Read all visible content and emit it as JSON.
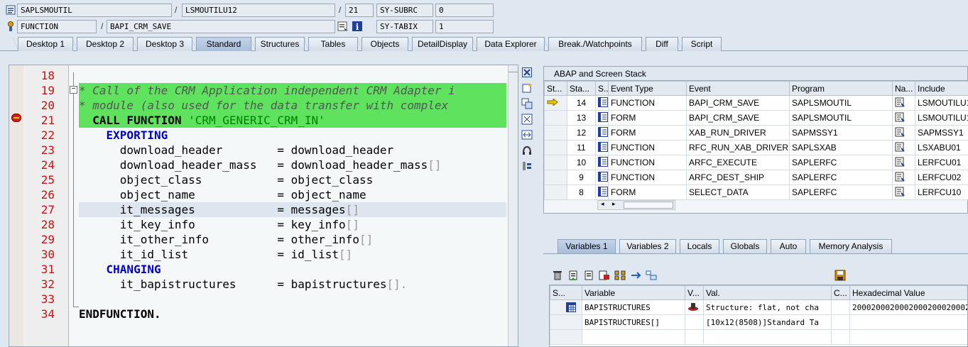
{
  "header": {
    "program": "SAPLSMOUTIL",
    "include": "LSMOUTILU12",
    "line": "21",
    "subrc_label": "SY-SUBRC",
    "subrc_value": "0",
    "event_type": "FUNCTION",
    "event": "BAPI_CRM_SAVE",
    "tabix_label": "SY-TABIX",
    "tabix_value": "1",
    "slash": "/"
  },
  "tabs": [
    "Desktop 1",
    "Desktop 2",
    "Desktop 3",
    "Standard",
    "Structures",
    "Tables",
    "Objects",
    "DetailDisplay",
    "Data Explorer",
    "Break./Watchpoints",
    "Diff",
    "Script"
  ],
  "active_tab": "Standard",
  "code": [
    {
      "num": "18",
      "text": ""
    },
    {
      "num": "19",
      "text": "* Call of the CRM Application independent CRM Adapter i"
    },
    {
      "num": "20",
      "text": "* module (also used for the data transfer with complex"
    },
    {
      "num": "21",
      "text_parts": [
        "  CALL FUNCTION ",
        "'CRM_GENERIC_CRM_IN'"
      ]
    },
    {
      "num": "22",
      "text": "    EXPORTING"
    },
    {
      "num": "23",
      "text": "      download_header        = download_header"
    },
    {
      "num": "24",
      "text": "      download_header_mass   = download_header_mass",
      "brk": "[]"
    },
    {
      "num": "25",
      "text": "      object_class           = object_class"
    },
    {
      "num": "26",
      "text": "      object_name            = object_name"
    },
    {
      "num": "27",
      "text": "      it_messages            = messages",
      "brk": "[]"
    },
    {
      "num": "28",
      "text": "      it_key_info            = key_info",
      "brk": "[]"
    },
    {
      "num": "29",
      "text": "      it_other_info          = other_info",
      "brk": "[]"
    },
    {
      "num": "30",
      "text": "      it_id_list             = id_list",
      "brk": "[]"
    },
    {
      "num": "31",
      "text": "    CHANGING"
    },
    {
      "num": "32",
      "text": "      it_bapistructures      = bapistructures",
      "brk": "[]."
    },
    {
      "num": "33",
      "text": ""
    },
    {
      "num": "34",
      "text": "ENDFUNCTION."
    }
  ],
  "stack": {
    "title": "ABAP and Screen Stack",
    "columns": [
      "St...",
      "Sta...",
      "S...",
      "Event Type",
      "Event",
      "Program",
      "Na...",
      "Include"
    ],
    "rows": [
      {
        "level": "14",
        "type": "FUNCTION",
        "event": "BAPI_CRM_SAVE",
        "program": "SAPLSMOUTIL",
        "include": "LSMOUTILU1",
        "current": true
      },
      {
        "level": "13",
        "type": "FORM",
        "event": "BAPI_CRM_SAVE",
        "program": "SAPLSMOUTIL",
        "include": "LSMOUTILU1"
      },
      {
        "level": "12",
        "type": "FORM",
        "event": "XAB_RUN_DRIVER",
        "program": "SAPMSSY1",
        "include": "SAPMSSY1"
      },
      {
        "level": "11",
        "type": "FUNCTION",
        "event": "RFC_RUN_XAB_DRIVER",
        "program": "SAPLSXAB",
        "include": "LSXABU01"
      },
      {
        "level": "10",
        "type": "FUNCTION",
        "event": "ARFC_EXECUTE",
        "program": "SAPLERFC",
        "include": "LERFCU01"
      },
      {
        "level": "9",
        "type": "FUNCTION",
        "event": "ARFC_DEST_SHIP",
        "program": "SAPLERFC",
        "include": "LERFCU02"
      },
      {
        "level": "8",
        "type": "FORM",
        "event": "SELECT_DATA",
        "program": "SAPLERFC",
        "include": "LERFCU10"
      }
    ]
  },
  "var_tabs": [
    "Variables 1",
    "Variables 2",
    "Locals",
    "Globals",
    "Auto",
    "Memory Analysis"
  ],
  "active_var_tab": "Variables 1",
  "variables": {
    "columns": [
      "S...",
      "Variable",
      "V...",
      "Val.",
      "C...",
      "Hexadecimal Value"
    ],
    "rows": [
      {
        "name": "BAPISTRUCTURES",
        "value": "Structure: flat, not cha",
        "hex": "2000200020002000200020002000"
      },
      {
        "name": "BAPISTRUCTURES[]",
        "value": "[10x12(8508)]Standard Ta",
        "hex": ""
      }
    ]
  }
}
